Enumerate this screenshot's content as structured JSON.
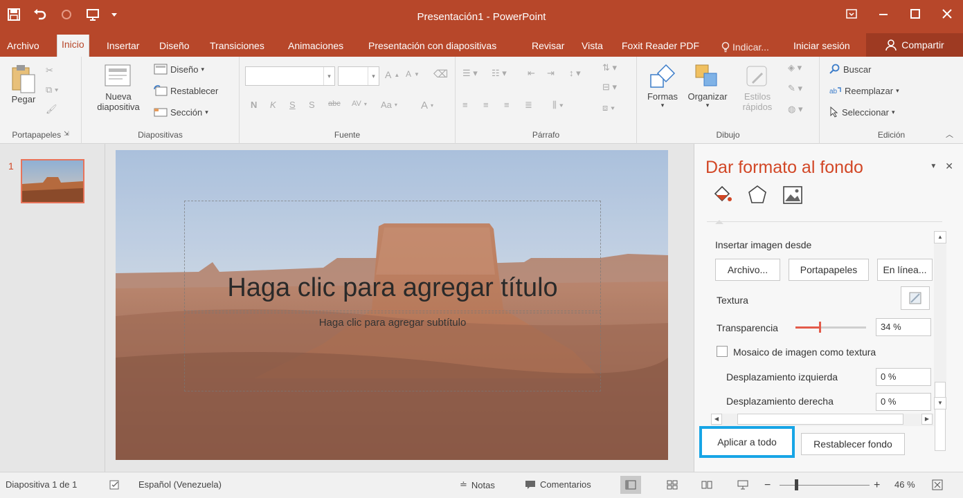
{
  "window": {
    "title": "Presentación1 - PowerPoint"
  },
  "tabs": [
    {
      "label": "Archivo"
    },
    {
      "label": "Inicio"
    },
    {
      "label": "Insertar"
    },
    {
      "label": "Diseño"
    },
    {
      "label": "Transiciones"
    },
    {
      "label": "Animaciones"
    },
    {
      "label": "Presentación con diapositivas"
    },
    {
      "label": "Revisar"
    },
    {
      "label": "Vista"
    },
    {
      "label": "Foxit Reader PDF"
    },
    {
      "label": "Indicar..."
    },
    {
      "label": "Iniciar sesión"
    },
    {
      "label": "Compartir"
    }
  ],
  "ribbon": {
    "portapapeles": {
      "paste": "Pegar",
      "group": "Portapapeles"
    },
    "diapositivas": {
      "new_slide_1": "Nueva",
      "new_slide_2": "diapositiva",
      "layout": "Diseño",
      "reset": "Restablecer",
      "section": "Sección",
      "group": "Diapositivas"
    },
    "fuente": {
      "group": "Fuente",
      "bold": "N",
      "italic": "K",
      "underline": "S",
      "shadow": "S",
      "strike": "abc",
      "spacing": "AV",
      "case": "Aa",
      "color": "A"
    },
    "parrafo": {
      "group": "Párrafo"
    },
    "dibujo": {
      "shapes": "Formas",
      "arrange": "Organizar",
      "styles_1": "Estilos",
      "styles_2": "rápidos",
      "group": "Dibujo"
    },
    "edicion": {
      "find": "Buscar",
      "replace": "Reemplazar",
      "select": "Seleccionar",
      "group": "Edición"
    }
  },
  "thumbnails": [
    {
      "number": "1"
    }
  ],
  "slide": {
    "title_placeholder": "Haga clic para agregar título",
    "subtitle_placeholder": "Haga clic para agregar subtítulo"
  },
  "format_pane": {
    "title": "Dar formato al fondo",
    "insert_from": "Insertar imagen desde",
    "btn_file": "Archivo...",
    "btn_clipboard": "Portapapeles",
    "btn_online": "En línea...",
    "texture_label": "Textura",
    "transparency_label": "Transparencia",
    "transparency_value": "34 %",
    "transparency_fraction": 0.34,
    "tile_label": "Mosaico de imagen como textura",
    "offset_left_label": "Desplazamiento izquierda",
    "offset_left_value": "0 %",
    "offset_right_label": "Desplazamiento derecha",
    "offset_right_value": "0 %",
    "apply_all": "Aplicar a todo",
    "reset_bg": "Restablecer fondo"
  },
  "statusbar": {
    "slide_info": "Diapositiva 1 de 1",
    "language": "Español (Venezuela)",
    "notes": "Notas",
    "comments": "Comentarios",
    "zoom": "46 %"
  },
  "colors": {
    "accent": "#b7472a",
    "highlight": "#17a5e6"
  }
}
